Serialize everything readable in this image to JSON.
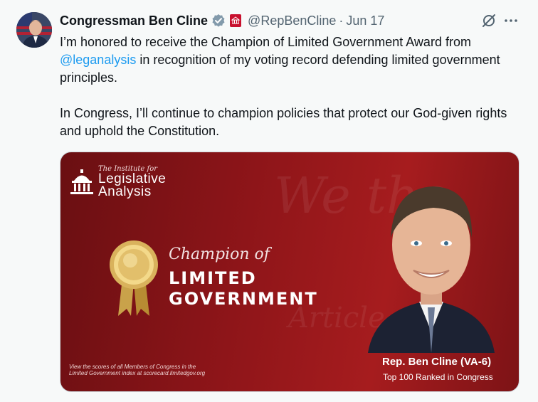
{
  "tweet": {
    "author_name": "Congressman Ben Cline",
    "handle": "@RepBenCline",
    "separator": "·",
    "date": "Jun 17",
    "text_part1": "I’m honored to receive the Champion of Limited Government Award from ",
    "mention": "@leganalysis",
    "text_part2": " in recognition of my voting record defending limited government principles.",
    "text_para2": "In Congress, I’ll continue to champion policies that protect our God-given rights and uphold the Constitution."
  },
  "media": {
    "logo_small": "The Institute for",
    "logo_line1": "Legislative",
    "logo_line2": "Analysis",
    "champion_of": "Champion of",
    "limited": "LIMITED",
    "government": "GOVERNMENT",
    "footnote": "View the scores of all Members of Congress in the Limited Government index at scorecard.limitedgov.org",
    "rep_name": "Rep. Ben Cline (VA-6)",
    "rep_rank": "Top 100 Ranked in Congress",
    "background_color": "#8e1519"
  },
  "icons": {
    "verified": "verified-badge-icon",
    "government": "government-badge-icon",
    "grok": "grok-icon",
    "more": "more-icon"
  },
  "colors": {
    "link": "#1d9bf0",
    "muted": "#536471",
    "text": "#0f1419"
  }
}
